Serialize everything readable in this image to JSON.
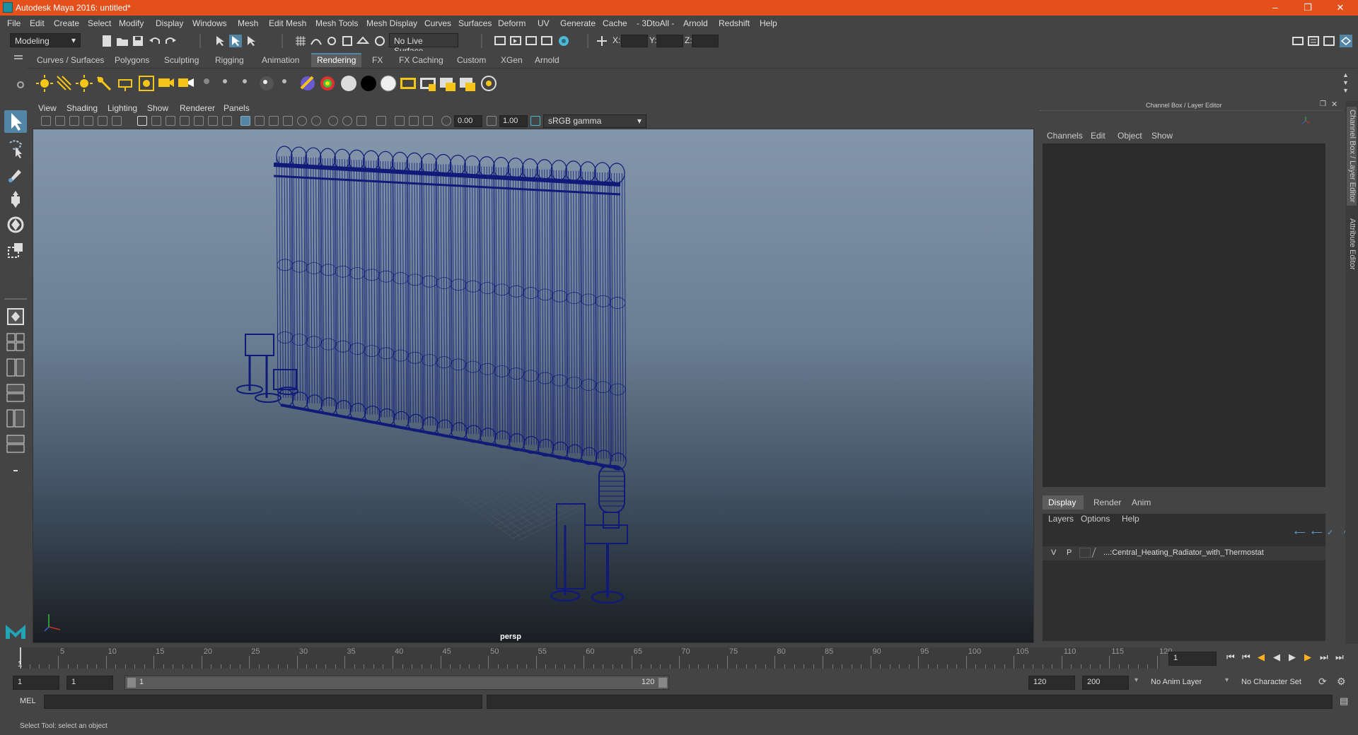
{
  "window": {
    "title": "Autodesk Maya 2016: untitled*"
  },
  "menubar": [
    "File",
    "Edit",
    "Create",
    "Select",
    "Modify",
    "Display",
    "Windows",
    "Mesh",
    "Edit Mesh",
    "Mesh Tools",
    "Mesh Display",
    "Curves",
    "Surfaces",
    "Deform",
    "UV",
    "Generate",
    "Cache",
    "- 3DtoAll -",
    "Arnold",
    "Redshift",
    "Help"
  ],
  "statusline": {
    "mode_selector": "Modeling",
    "live_surface": "No Live Surface",
    "x_label": "X:",
    "y_label": "Y:",
    "z_label": "Z:"
  },
  "shelf": {
    "tabs": [
      "Curves / Surfaces",
      "Polygons",
      "Sculpting",
      "Rigging",
      "Animation",
      "Rendering",
      "FX",
      "FX Caching",
      "Custom",
      "XGen",
      "Arnold"
    ],
    "active_tab": "Rendering"
  },
  "viewport": {
    "menus": [
      "View",
      "Shading",
      "Lighting",
      "Show",
      "Renderer",
      "Panels"
    ],
    "exposure": "0.00",
    "gamma": "1.00",
    "color_space": "sRGB gamma",
    "camera_label": "persp"
  },
  "right_panel": {
    "title": "Channel Box / Layer Editor",
    "channel_menus": [
      "Channels",
      "Edit",
      "Object",
      "Show"
    ],
    "layer_tabs": [
      "Display",
      "Render",
      "Anim"
    ],
    "active_layer_tab": "Display",
    "layer_menus": [
      "Layers",
      "Options",
      "Help"
    ],
    "layer_row": {
      "v": "V",
      "p": "P",
      "name": "...:Central_Heating_Radiator_with_Thermostat"
    },
    "side_tabs": [
      "Channel Box / Layer Editor",
      "Attribute Editor"
    ]
  },
  "timeslider": {
    "ticks": [
      "5",
      "10",
      "15",
      "20",
      "25",
      "30",
      "35",
      "40",
      "45",
      "50",
      "55",
      "60",
      "65",
      "70",
      "75",
      "80",
      "85",
      "90",
      "95",
      "100",
      "105",
      "110",
      "115",
      "120"
    ],
    "start_marker": "1",
    "current_frame": "1"
  },
  "rangeslider": {
    "start": "1",
    "playback_start": "1",
    "range_start_label": "1",
    "range_end_label": "120",
    "playback_end": "120",
    "end": "200",
    "anim_layer": "No Anim Layer",
    "character_set": "No Character Set"
  },
  "cmdline": {
    "label": "MEL"
  },
  "helpline": {
    "text": "Select Tool: select an object"
  },
  "colors": {
    "titlebar": "#e4501c",
    "accent": "#5285a6",
    "wire": "#101a78"
  }
}
